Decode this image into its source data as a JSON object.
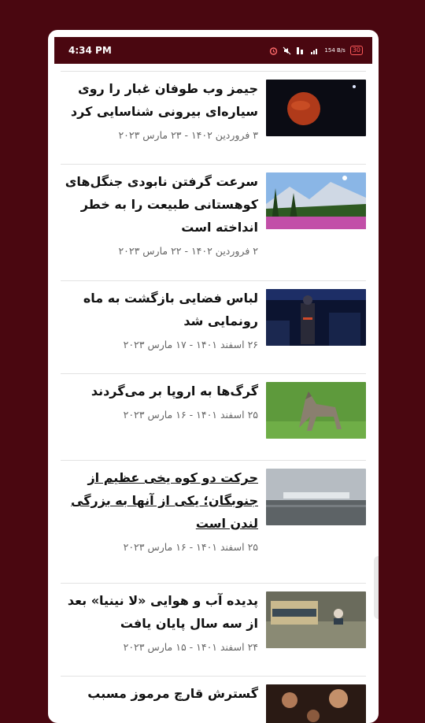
{
  "status_bar": {
    "time": "4:34 PM",
    "network_speed": "154 B/s",
    "battery": "30"
  },
  "articles": [
    {
      "title": "جیمز وب طوفان غبار را روی سیاره‌ای بیرونی شناسایی کرد",
      "date": "۳ فروردین ۱۴۰۲ - ۲۳ مارس ۲۰۲۳",
      "image": "planet-image"
    },
    {
      "title": "سرعت گرفتن نابودی جنگل‌های کوهستانی طبیعت را به خطر انداخته است",
      "date": "۲ فروردین ۱۴۰۲ - ۲۲ مارس ۲۰۲۳",
      "image": "mountain-forest-image"
    },
    {
      "title": "لباس فضایی بازگشت به ماه رونمایی شد",
      "date": "۲۶ اسفند ۱۴۰۱ - ۱۷ مارس ۲۰۲۳",
      "image": "spacesuit-image"
    },
    {
      "title": "گرگ‌ها به اروپا بر می‌گردند",
      "date": "۲۵ اسفند ۱۴۰۱ - ۱۶ مارس ۲۰۲۳",
      "image": "wolf-image"
    },
    {
      "title": "حرکت دو کوه یخی عظیم از جنوبگان؛ یکی از آنها به بزرگی لندن است",
      "date": "۲۵ اسفند ۱۴۰۱ - ۱۶ مارس ۲۰۲۳",
      "image": "iceberg-image"
    },
    {
      "title": "پدیده آب و هوایی «لا نینیا» بعد از سه سال پایان یافت",
      "date": "۲۴ اسفند ۱۴۰۱ - ۱۵ مارس ۲۰۲۳",
      "image": "flood-image"
    },
    {
      "title": "گسترش قارچ مرموز مسبب",
      "date": "",
      "image": "fungus-image"
    }
  ]
}
